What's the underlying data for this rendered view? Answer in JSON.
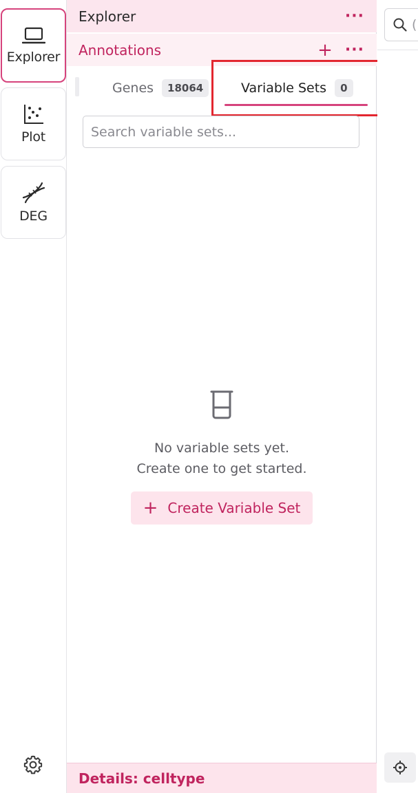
{
  "rail": {
    "items": [
      {
        "label": "Explorer",
        "icon": "laptop-icon",
        "active": true
      },
      {
        "label": "Plot",
        "icon": "scatter-plot-icon",
        "active": false
      },
      {
        "label": "DEG",
        "icon": "dna-icon",
        "active": false
      }
    ],
    "settings_icon": "gear-icon"
  },
  "panel": {
    "title": "Explorer",
    "menu_glyph": "···",
    "section": {
      "title": "Annotations",
      "add_glyph": "+",
      "menu_glyph": "···"
    },
    "tabs": [
      {
        "label": "Genes",
        "count": "18064",
        "selected": false
      },
      {
        "label": "Variable Sets",
        "count": "0",
        "selected": true
      }
    ],
    "search": {
      "placeholder": "Search variable sets...",
      "value": ""
    },
    "empty_state": {
      "icon": "beaker-icon",
      "line1": "No variable sets yet.",
      "line2": "Create one to get started.",
      "button_label": "Create Variable Set",
      "button_glyph": "+"
    },
    "footer": {
      "text": "Details: celltype"
    }
  },
  "right": {
    "search_icon": "search-icon",
    "search_cut_text": "(",
    "locate_icon": "crosshair-icon"
  },
  "colors": {
    "accent": "#c0245e",
    "accent_soft": "#fde4ec",
    "highlight": "#e3262f"
  }
}
